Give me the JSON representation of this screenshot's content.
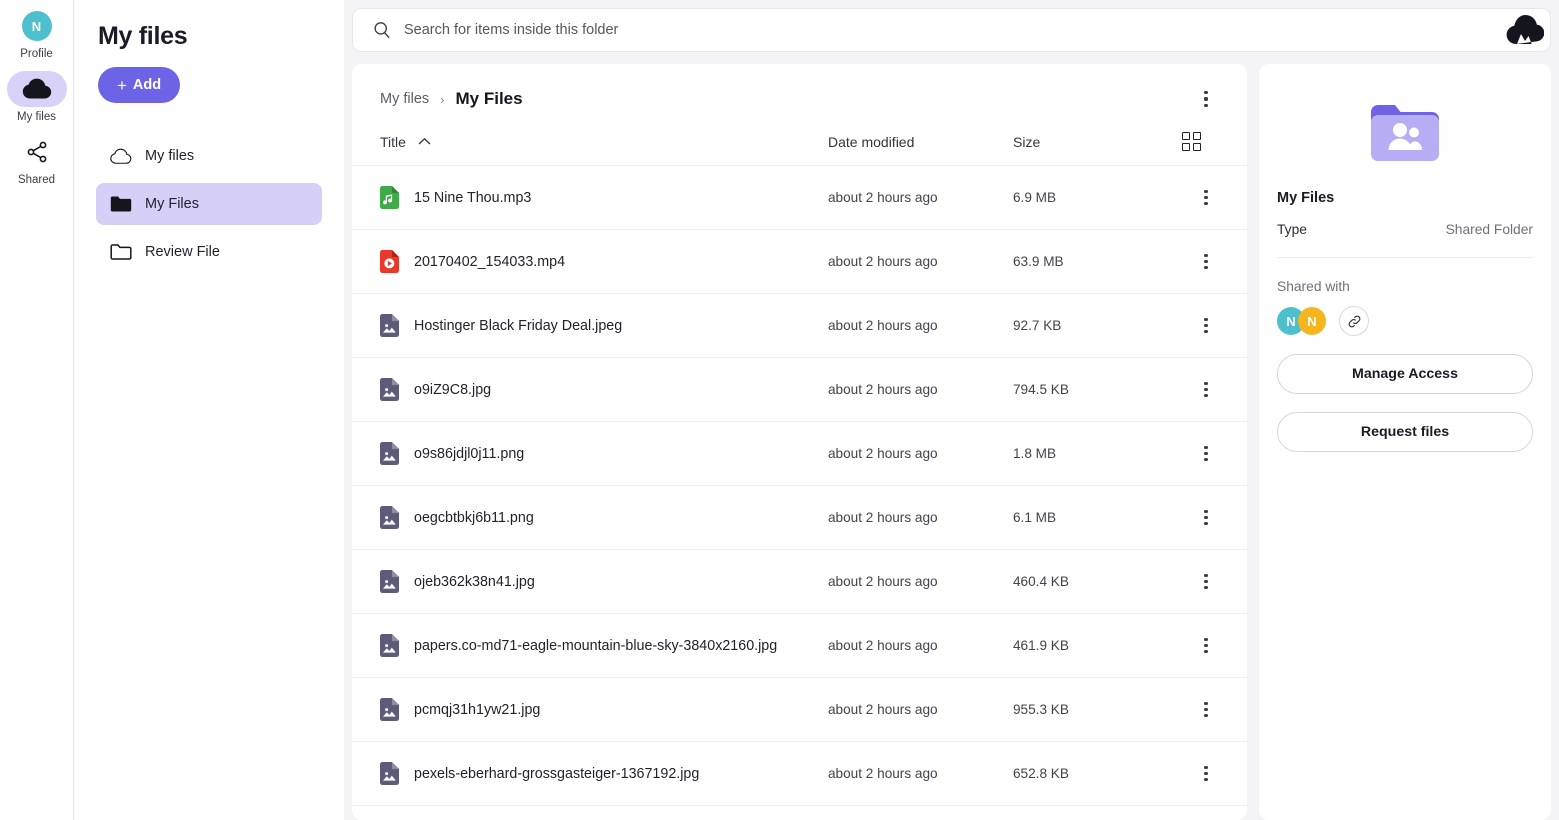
{
  "colors": {
    "accent_purple": "#6d63e6",
    "nav_active_bg": "#d6cff7",
    "rail_active_bg": "#d9d2f8",
    "avatar_teal": "#4ec0cd",
    "avatar_amber": "#f5b51f",
    "folder_light": "#b7adf5",
    "folder_tab": "#6f62e3",
    "audio_green": "#3dab4a",
    "video_red": "#e8392b",
    "image_slate": "#5c5c7a",
    "page_bg": "#f4f4f6"
  },
  "brand": {
    "logo_icon": "cloud-logo-icon"
  },
  "rail": {
    "items": [
      {
        "label": "Profile",
        "icon": "profile-avatar-icon",
        "initial": "N",
        "active": false
      },
      {
        "label": "My files",
        "icon": "cloud-icon",
        "active": true
      },
      {
        "label": "Shared",
        "icon": "share-nodes-icon",
        "active": false
      }
    ]
  },
  "sidebar": {
    "title": "My files",
    "add_button": {
      "label": "Add",
      "plus": "+"
    },
    "nav_items": [
      {
        "label": "My files",
        "icon": "cloud-outline-icon",
        "active": false
      },
      {
        "label": "My Files",
        "icon": "folder-filled-icon",
        "active": true
      },
      {
        "label": "Review File",
        "icon": "folder-outline-icon",
        "active": false
      }
    ]
  },
  "search": {
    "placeholder": "Search for items inside this folder",
    "value": "",
    "icon": "search-icon"
  },
  "card": {
    "breadcrumb": {
      "parent": "My files",
      "separator": "›",
      "current": "My Files"
    },
    "menu_icon": "kebab-menu-icon",
    "columns": {
      "title": "Title",
      "sort_indicator": "chevron-up-icon",
      "date_modified": "Date modified",
      "size": "Size",
      "view_toggle_icon": "grid-view-icon"
    },
    "files": [
      {
        "name": "15 Nine Thou.mp3",
        "date": "about 2 hours ago",
        "size": "6.9 MB",
        "type": "audio"
      },
      {
        "name": "20170402_154033.mp4",
        "date": "about 2 hours ago",
        "size": "63.9 MB",
        "type": "video"
      },
      {
        "name": "Hostinger Black Friday Deal.jpeg",
        "date": "about 2 hours ago",
        "size": "92.7 KB",
        "type": "image"
      },
      {
        "name": "o9iZ9C8.jpg",
        "date": "about 2 hours ago",
        "size": "794.5 KB",
        "type": "image"
      },
      {
        "name": "o9s86jdjl0j11.png",
        "date": "about 2 hours ago",
        "size": "1.8 MB",
        "type": "image"
      },
      {
        "name": "oegcbtbkj6b11.png",
        "date": "about 2 hours ago",
        "size": "6.1 MB",
        "type": "image"
      },
      {
        "name": "ojeb362k38n41.jpg",
        "date": "about 2 hours ago",
        "size": "460.4 KB",
        "type": "image"
      },
      {
        "name": "papers.co-md71-eagle-mountain-blue-sky-3840x2160.jpg",
        "date": "about 2 hours ago",
        "size": "461.9 KB",
        "type": "image"
      },
      {
        "name": "pcmqj31h1yw21.jpg",
        "date": "about 2 hours ago",
        "size": "955.3 KB",
        "type": "image"
      },
      {
        "name": "pexels-eberhard-grossgasteiger-1367192.jpg",
        "date": "about 2 hours ago",
        "size": "652.8 KB",
        "type": "image"
      }
    ]
  },
  "details": {
    "folder_icon": "shared-folder-icon",
    "name": "My Files",
    "type_key": "Type",
    "type_value": "Shared Folder",
    "shared_with_label": "Shared with",
    "avatars": [
      {
        "initial": "N",
        "color": "#4ec0cd"
      },
      {
        "initial": "N",
        "color": "#f5b51f"
      }
    ],
    "link_icon": "link-chain-icon",
    "manage_access_label": "Manage Access",
    "request_files_label": "Request files"
  }
}
